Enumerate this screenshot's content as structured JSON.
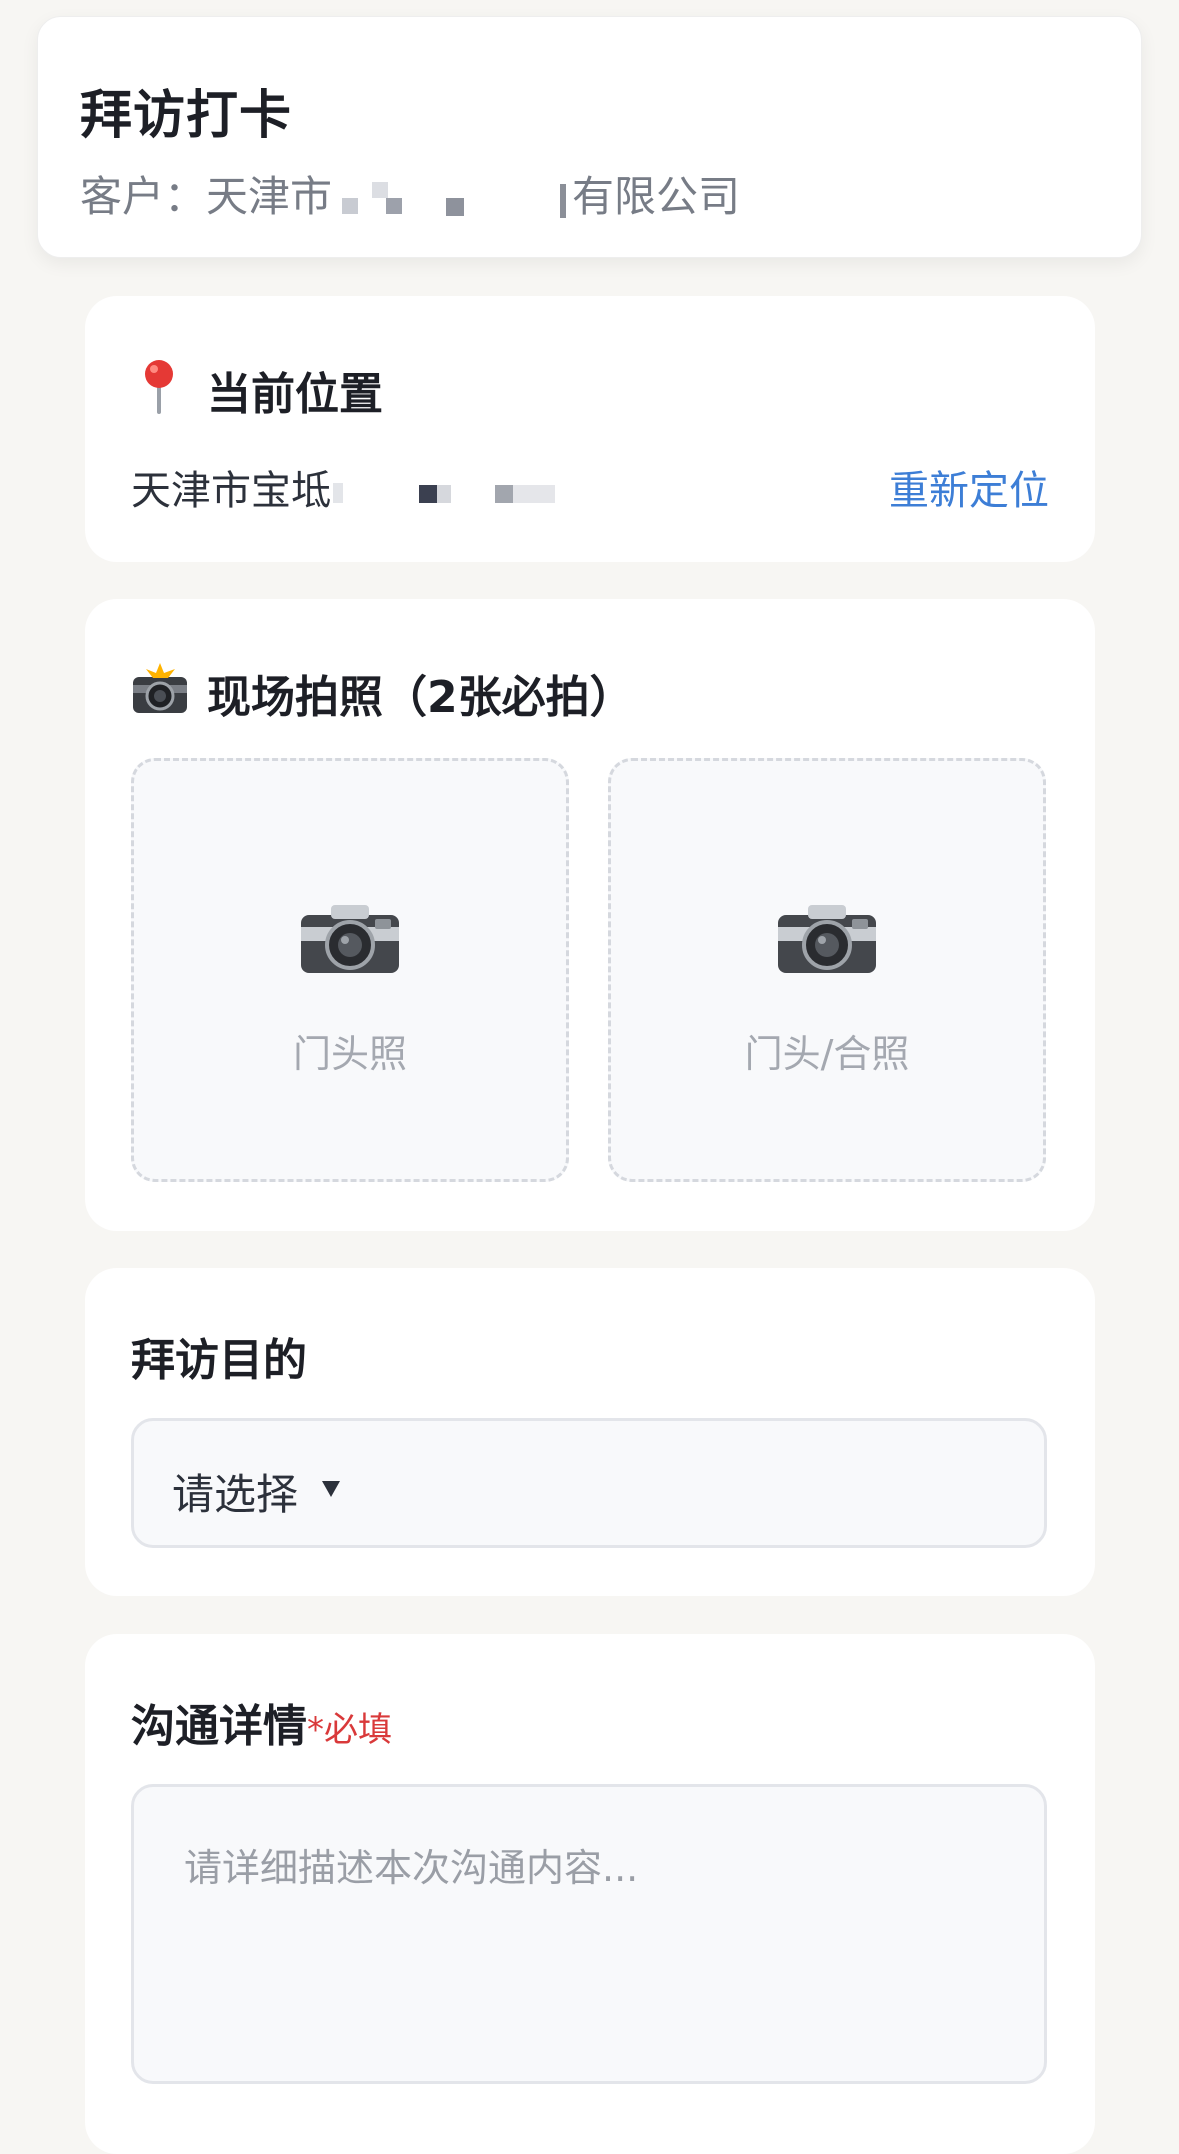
{
  "header": {
    "title": "拜访打卡",
    "customer_label": "客户：",
    "customer_name_start": "天津市",
    "customer_name_end": "有限公司"
  },
  "location": {
    "icon": "pin-icon",
    "title": "当前位置",
    "address": "天津市宝坻",
    "relocate_label": "重新定位",
    "link_color": "#3d7ed6"
  },
  "photos": {
    "icon": "camera-flash-icon",
    "title": "现场拍照（2张必拍）",
    "slots": [
      {
        "icon": "camera-icon",
        "label": "门头照"
      },
      {
        "icon": "camera-icon",
        "label": "门头/合照"
      }
    ]
  },
  "purpose": {
    "title": "拜访目的",
    "select_value": "请选择",
    "caret": "▼"
  },
  "detail": {
    "title": "沟通详情",
    "required_mark": "*必填",
    "required_color": "#d9393a",
    "placeholder": "请详细描述本次沟通内容..."
  }
}
